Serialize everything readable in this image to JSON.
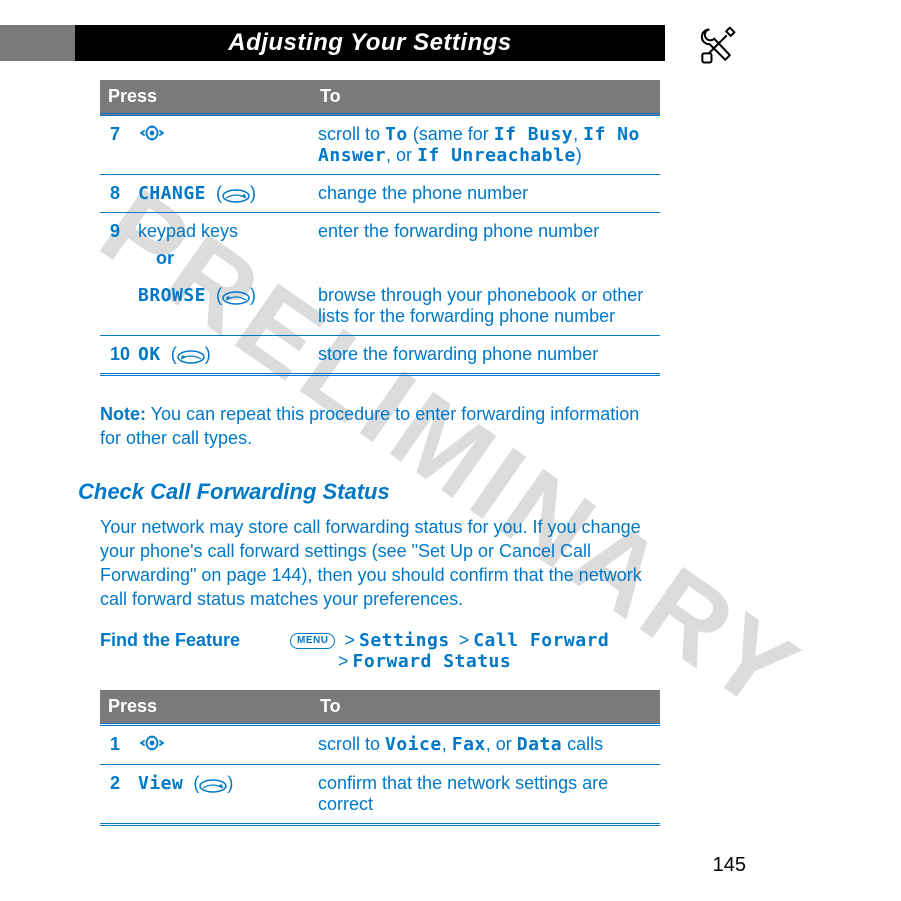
{
  "watermark": "PRELIMINARY",
  "header": {
    "title": "Adjusting Your Settings",
    "icon": "tools-icon"
  },
  "table1": {
    "head_press": "Press",
    "head_to": "To",
    "rows": [
      {
        "num": "7",
        "press_kind": "nav",
        "to_parts": {
          "t1": "scroll to ",
          "b1": "To",
          "t2": " (same for ",
          "b2": "If Busy",
          "t3": ", ",
          "b3": "If No Answer",
          "t4": ", or ",
          "b4": "If Unreachable",
          "t5": ")"
        }
      },
      {
        "num": "8",
        "press_label": "CHANGE",
        "press_kind": "oval",
        "to": "change the phone number"
      },
      {
        "num": "9",
        "press_label_a": "keypad keys",
        "or": "or",
        "press_label_b": "BROWSE",
        "press_b_kind": "oval",
        "to_a": "enter the forwarding phone number",
        "to_b": "browse through your phonebook or other lists for the forwarding phone number"
      },
      {
        "num": "10",
        "press_label": "OK",
        "press_kind": "oval",
        "to": "store the forwarding phone number"
      }
    ]
  },
  "note": {
    "label": "Note:",
    "text": " You can repeat this procedure to enter forwarding information for other call types."
  },
  "subheading": "Check Call Forwarding Status",
  "para": "Your network may store call forwarding status for you. If you change your phone's call forward settings (see \"Set Up or Cancel Call Forwarding\" on page 144), then you should confirm that the network call forward status matches your preferences.",
  "ftf": {
    "label": "Find the Feature",
    "menu": "MENU",
    "gt": ">",
    "p1": "Settings",
    "p2": "Call Forward",
    "p3": "Forward Status"
  },
  "table2": {
    "head_press": "Press",
    "head_to": "To",
    "rows": [
      {
        "num": "1",
        "press_kind": "nav",
        "to_parts": {
          "t1": "scroll to ",
          "b1": "Voice",
          "t2": ", ",
          "b2": "Fax",
          "t3": ", or ",
          "b3": "Data",
          "t4": " calls"
        }
      },
      {
        "num": "2",
        "press_label": "View",
        "press_kind": "oval",
        "to": "confirm that the network settings are correct"
      }
    ]
  },
  "page_number": "145"
}
